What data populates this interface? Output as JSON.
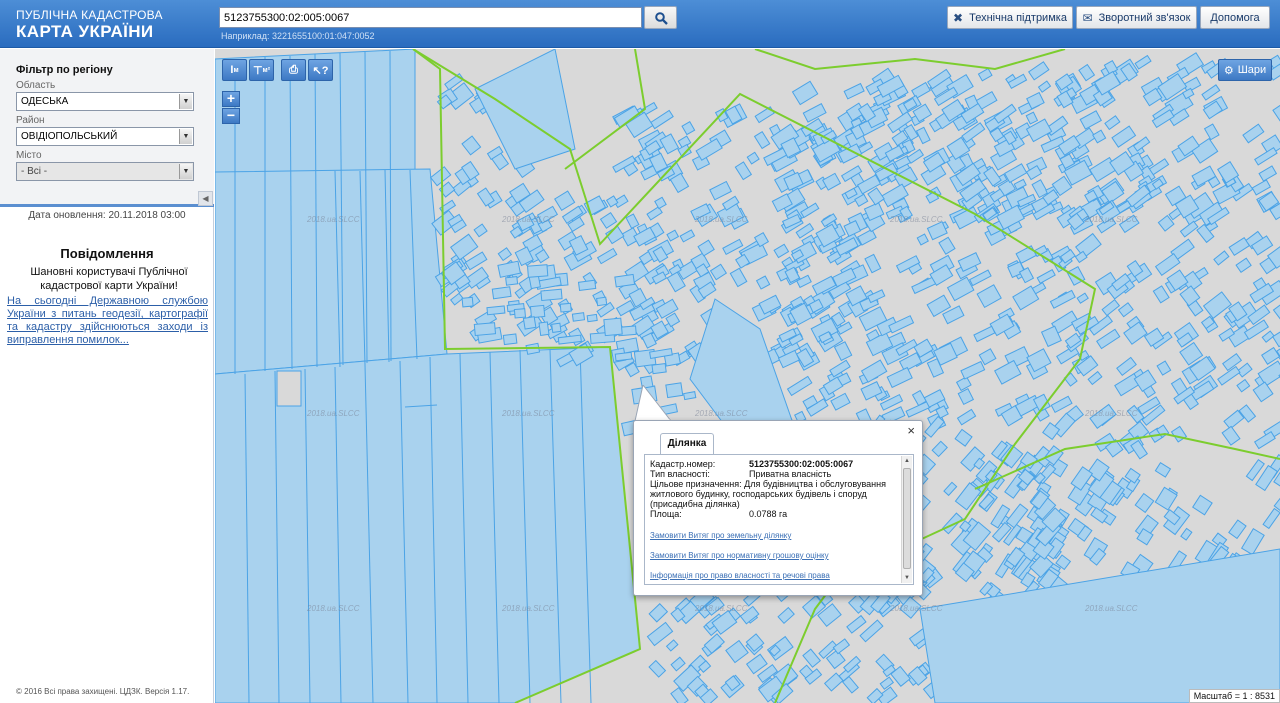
{
  "header": {
    "logo_line1": "ПУБЛІЧНА КАДАСТРОВА",
    "logo_line2": "КАРТА УКРАЇНИ",
    "search_value": "5123755300:02:005:0067",
    "example_text": "Наприклад: 3221655100:01:047:0052",
    "support_label": "Технічна підтримка",
    "feedback_label": "Зворотний зв'язок",
    "help_label": "Допомога"
  },
  "sidebar": {
    "filter_title": "Фільтр по регіону",
    "region_label": "Область",
    "region_value": "ОДЕСЬКА",
    "district_label": "Район",
    "district_value": "ОВІДІОПОЛЬСЬКИЙ",
    "city_label": "Місто",
    "city_value": "- Всі -",
    "update_date": "Дата оновлення: 20.11.2018 03:00",
    "notice_title": "Повідомлення",
    "notice_body": "Шановні користувачі Публічної кадастрової карти України!",
    "notice_link": "На сьогодні Державною службою України з питань геодезії, картографії та кадастру здійснюються заходи із виправлення помилок...",
    "footer": "© 2016 Всі права захищені. ЦДЗК. Версія 1.17."
  },
  "map": {
    "tools": {
      "measure_length": "м",
      "measure_area": "м²"
    },
    "zoom_in": "+",
    "zoom_out": "−",
    "layers_label": "Шари",
    "watermark": "2018.ua.SLCC",
    "scale_text": "Масштаб = 1 : 8531",
    "parcel_fill": "#a9d2ee",
    "parcel_stroke": "#4ba3e6",
    "boundary_color": "#7ccd2e"
  },
  "popup": {
    "tab_label": "Ділянка",
    "cadastral_key": "Кадастр.номер:",
    "cadastral_value": "5123755300:02:005:0067",
    "ownership_key": "Тип власності:",
    "ownership_value": "Приватна власність",
    "purpose_key": "Цільове призначення:",
    "purpose_value": "Для будівництва і обслуговування житлового будинку, господарських будівель і споруд (присадибна ділянка)",
    "area_key": "Площа:",
    "area_value": "0.0788 га",
    "link1": "Замовити Витяг про земельну ділянку",
    "link2": "Замовити Витяг про нормативну грошову оцінку",
    "link3": "Інформація про право власності та речові права",
    "close": "×"
  }
}
